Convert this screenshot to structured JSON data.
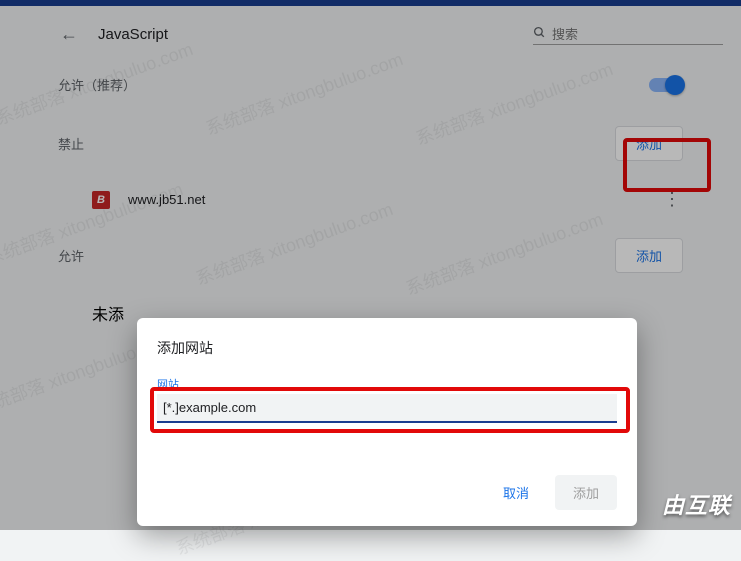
{
  "header": {
    "title": "JavaScript",
    "search_placeholder": "搜索"
  },
  "sections": {
    "allow_recommend": "允许（推荐）",
    "block_label": "禁止",
    "block_add_label": "添加",
    "block_sites": [
      {
        "url": "www.jb51.net"
      }
    ],
    "allow_label": "允许",
    "allow_add_label": "添加",
    "allow_empty_prefix": "未添"
  },
  "dialog": {
    "title": "添加网站",
    "field_label": "网站",
    "input_value": "[*.]example.com",
    "cancel_label": "取消",
    "confirm_label": "添加"
  },
  "watermark_text": "系统部落 xitongbuluo.com",
  "brand": "由互联"
}
